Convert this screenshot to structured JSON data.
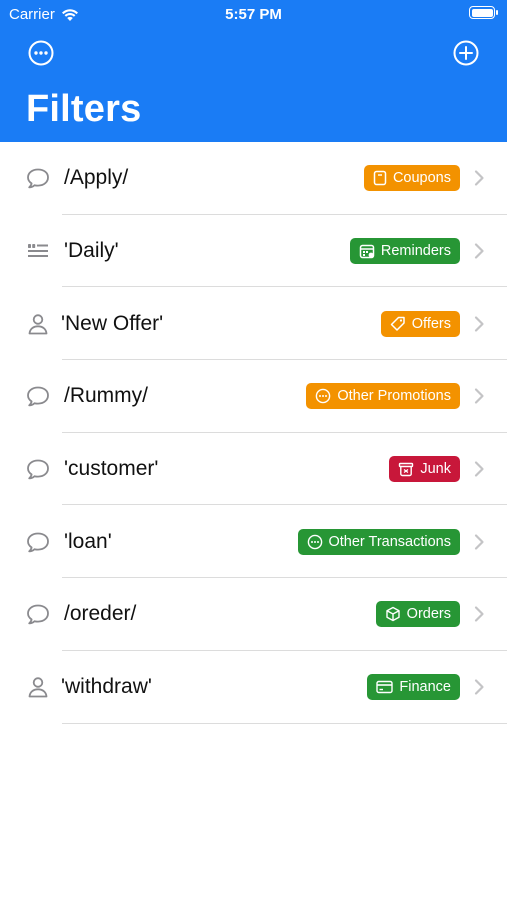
{
  "status_bar": {
    "carrier": "Carrier",
    "time": "5:57 PM"
  },
  "header": {
    "title": "Filters",
    "more_icon": "ellipsis-circle-icon",
    "add_icon": "plus-circle-icon",
    "background": "#1a7cf5"
  },
  "colors": {
    "orange": "#f39200",
    "green": "#279635",
    "red": "#c8173a",
    "chevron": "#c4c4c6",
    "row_icon": "#8a8a8e"
  },
  "filters": [
    {
      "label": "/Apply/",
      "source_icon": "message-bubble-icon",
      "badge": "Coupons",
      "badge_icon": "coupon-icon",
      "badge_color": "#f39200"
    },
    {
      "label": "'Daily'",
      "source_icon": "text-lines-icon",
      "badge": "Reminders",
      "badge_icon": "calendar-icon",
      "badge_color": "#279635"
    },
    {
      "label": "'New Offer'",
      "source_icon": "person-icon",
      "badge": "Offers",
      "badge_icon": "tag-icon",
      "badge_color": "#f39200"
    },
    {
      "label": "/Rummy/",
      "source_icon": "message-bubble-icon",
      "badge": "Other Promotions",
      "badge_icon": "ellipsis-circle-icon",
      "badge_color": "#f39200"
    },
    {
      "label": "'customer'",
      "source_icon": "message-bubble-icon",
      "badge": "Junk",
      "badge_icon": "trash-box-icon",
      "badge_color": "#c8173a"
    },
    {
      "label": "'loan'",
      "source_icon": "message-bubble-icon",
      "badge": "Other Transactions",
      "badge_icon": "ellipsis-circle-icon",
      "badge_color": "#279635"
    },
    {
      "label": "/oreder/",
      "source_icon": "message-bubble-icon",
      "badge": "Orders",
      "badge_icon": "box-icon",
      "badge_color": "#279635"
    },
    {
      "label": "'withdraw'",
      "source_icon": "person-icon",
      "badge": "Finance",
      "badge_icon": "credit-card-icon",
      "badge_color": "#279635"
    }
  ]
}
